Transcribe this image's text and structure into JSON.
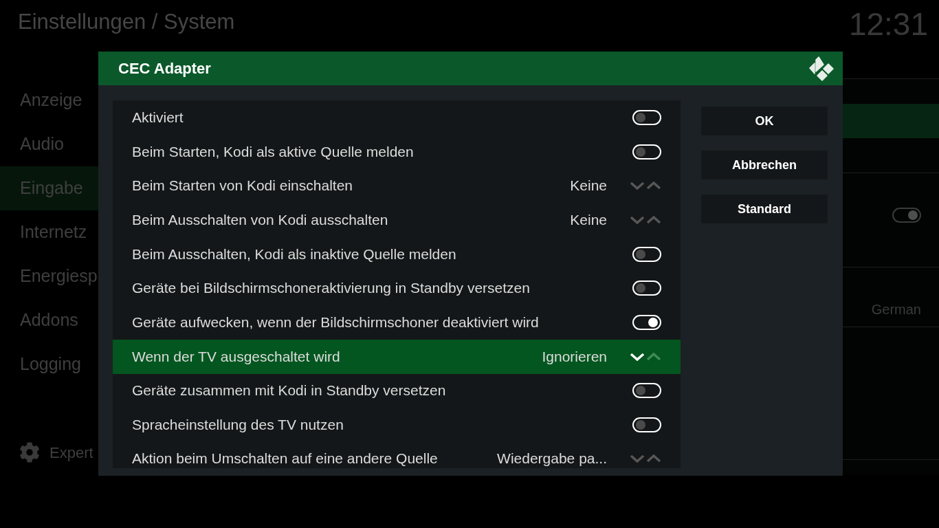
{
  "header": {
    "title": "Einstellungen / System",
    "clock": "12:31"
  },
  "sidebar": {
    "items": [
      {
        "label": "Anzeige",
        "selected": false
      },
      {
        "label": "Audio",
        "selected": false
      },
      {
        "label": "Eingabe",
        "selected": true
      },
      {
        "label": "Internetz",
        "selected": false
      },
      {
        "label": "Energiesp",
        "selected": false
      },
      {
        "label": "Addons",
        "selected": false
      },
      {
        "label": "Logging",
        "selected": false
      }
    ],
    "level_button": {
      "label": "Expert"
    }
  },
  "settings_panel": {
    "groups": [
      {
        "rows": [
          {
            "kind": "blank",
            "selected": true
          },
          {
            "kind": "blank",
            "selected": false
          }
        ]
      },
      {
        "rows": [
          {
            "kind": "toggle",
            "on": true,
            "selected": false
          },
          {
            "kind": "blank",
            "selected": false
          }
        ]
      },
      {
        "rows": [
          {
            "kind": "value",
            "value": "German",
            "selected": false
          }
        ]
      }
    ]
  },
  "dialog": {
    "title": "CEC Adapter",
    "rows": [
      {
        "kind": "toggle",
        "label": "Aktiviert",
        "on": false,
        "selected": false
      },
      {
        "kind": "toggle",
        "label": "Beim Starten, Kodi als aktive Quelle melden",
        "on": false,
        "selected": false
      },
      {
        "kind": "spinner",
        "label": "Beim Starten von Kodi einschalten",
        "value": "Keine",
        "selected": false
      },
      {
        "kind": "spinner",
        "label": "Beim Ausschalten von Kodi ausschalten",
        "value": "Keine",
        "selected": false
      },
      {
        "kind": "toggle",
        "label": "Beim Ausschalten, Kodi als inaktive Quelle melden",
        "on": false,
        "selected": false
      },
      {
        "kind": "toggle",
        "label": "Geräte bei Bildschirmschoneraktivierung in Standby versetzen",
        "on": false,
        "selected": false
      },
      {
        "kind": "toggle",
        "label": "Geräte aufwecken, wenn der Bildschirmschoner deaktiviert wird",
        "on": true,
        "selected": false
      },
      {
        "kind": "spinner",
        "label": "Wenn der TV ausgeschaltet wird",
        "value": "Ignorieren",
        "selected": true
      },
      {
        "kind": "toggle",
        "label": "Geräte zusammen mit Kodi in Standby versetzen",
        "on": false,
        "selected": false
      },
      {
        "kind": "toggle",
        "label": "Spracheinstellung des TV nutzen",
        "on": false,
        "selected": false
      },
      {
        "kind": "spinner",
        "label": "Aktion beim Umschalten auf eine andere Quelle",
        "value": "Wiedergabe pa...",
        "selected": false
      }
    ],
    "buttons": [
      "OK",
      "Abbrechen",
      "Standard"
    ]
  }
}
